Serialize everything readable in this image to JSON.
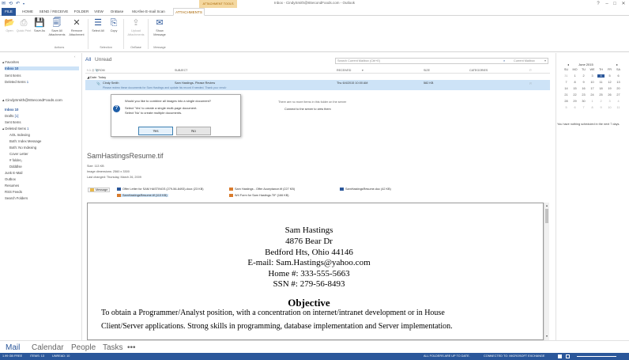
{
  "window": {
    "title": "Inbox - CindySmith@8SecondFoods.com - Outlook",
    "context_tab_group": "ATTACHMENT TOOLS"
  },
  "ribbon_tabs": [
    "FILE",
    "HOME",
    "SEND / RECEIVE",
    "FOLDER",
    "VIEW",
    "OnBase",
    "McAfee E-mail Scan",
    "ATTACHMENTS"
  ],
  "ribbon": {
    "buttons": [
      {
        "label": "Open",
        "icon": "open-icon"
      },
      {
        "label": "Quick Print",
        "icon": "printer-icon"
      },
      {
        "label": "Save As",
        "icon": "save-icon"
      },
      {
        "label": "Save All Attachments",
        "icon": "save-all-icon"
      },
      {
        "label": "Remove Attachment",
        "icon": "remove-icon"
      },
      {
        "label": "Select All",
        "icon": "select-all-icon"
      },
      {
        "label": "Copy",
        "icon": "copy-icon"
      },
      {
        "label": "Upload Attachments",
        "icon": "upload-icon"
      },
      {
        "label": "Show Message",
        "icon": "show-message-icon"
      }
    ],
    "groups": [
      "Actions",
      "Selection",
      "OnBase",
      "Message"
    ]
  },
  "folders": {
    "favorites_header": "Favorites",
    "favorites": [
      {
        "label": "Inbox",
        "count": "10"
      },
      {
        "label": "Sent Items",
        "count": ""
      },
      {
        "label": "Deleted Items",
        "count": "1"
      }
    ],
    "account": "CindySmith@8SecondFoods.com",
    "items": [
      {
        "label": "Inbox",
        "count": "10"
      },
      {
        "label": "Drafts",
        "count": "[1]"
      },
      {
        "label": "Sent Items",
        "count": ""
      },
      {
        "label": "Deleted Items",
        "count": "1"
      },
      {
        "label": "AOL Indexing",
        "count": ""
      },
      {
        "label": "Both: Index Message",
        "count": ""
      },
      {
        "label": "Both: No Indexing",
        "count": ""
      },
      {
        "label": "Cover Letter",
        "count": ""
      },
      {
        "label": "# folder₂",
        "count": ""
      },
      {
        "label": "Ddddlse",
        "count": ""
      },
      {
        "label": "Junk E-Mail",
        "count": ""
      },
      {
        "label": "Outbox",
        "count": ""
      },
      {
        "label": "Resumes",
        "count": ""
      },
      {
        "label": "RSS Feeds",
        "count": ""
      },
      {
        "label": "Search Folders",
        "count": ""
      }
    ]
  },
  "message_list": {
    "filter_all": "All",
    "filter_unread": "Unread",
    "search_placeholder": "Search Current Mailbox (Ctrl+E)",
    "search_scope": "Current Mailbox",
    "columns": [
      "FROM",
      "SUBJECT",
      "RECEIVED",
      "SIZE",
      "CATEGORIES"
    ],
    "group_header": "Date: Today",
    "row": {
      "from": "Cindy Smith",
      "subject": "Sam Hastings- Please Review",
      "preview": "Please review these documents for Sam Hastings and update his record if needed. Thank you <end>",
      "received": "Thu 6/4/2015 10:00 AM",
      "size": "582 KB"
    },
    "no_more_items": "There are no more items in this folder on the server",
    "connect_link": "Connect to the server to view them"
  },
  "dialog": {
    "question": "Would you like to combine all images into a single document?",
    "line1": "Select 'Yes' to create a single multi-page document.",
    "line2": "Select 'No' to create multiple documents.",
    "yes": "Yes",
    "no": "No"
  },
  "preview": {
    "file_name": "SamHastingsResume.tif",
    "size_line": "Size:  113 KB",
    "dims_line": "Image dimensions:   2560 x 3300",
    "changed_line": "Last changed:   Thursday, March 26, 2009",
    "message_label": "Message",
    "attachments": [
      {
        "label": "Offer Letter for SAM HASTINGS (279-56-8493).docx (23 KB)",
        "icon": "word-icon"
      },
      {
        "label": "Sam Hastings - Offer Acceptance.tif (227 KB)",
        "icon": "image-icon"
      },
      {
        "label": "SamHastingsResume.doc (42 KB)",
        "icon": "word-icon"
      },
      {
        "label": "SamHastingsResume.tif (113 KB)",
        "icon": "image-icon"
      },
      {
        "label": "W4 Form for Sam Hastings.TIF (166 KB)",
        "icon": "image-icon"
      }
    ],
    "document": {
      "name": "Sam Hastings",
      "address1": "4876 Bear Dr",
      "address2": "Bedford Hts, Ohio 44146",
      "email": "E-mail: Sam.Hastings@yahoo.com",
      "phone": "Home #: 333-555-5663",
      "ssn": "SSN #: 279-56-8493",
      "heading": "Objective",
      "objective1": "To obtain a Programmer/Analyst position, with a concentration on internet/intranet development or in House",
      "objective2": "Client/Server applications. Strong skills in programming, database implementation and Server implementation."
    }
  },
  "calendar": {
    "month": "June 2015",
    "day_headers": [
      "SU",
      "MO",
      "TU",
      "WE",
      "TH",
      "FR",
      "SA"
    ],
    "weeks": [
      [
        "31",
        "1",
        "2",
        "3",
        "4",
        "5",
        "6"
      ],
      [
        "7",
        "8",
        "9",
        "10",
        "11",
        "12",
        "13"
      ],
      [
        "14",
        "15",
        "16",
        "17",
        "18",
        "19",
        "20"
      ],
      [
        "21",
        "22",
        "23",
        "24",
        "25",
        "26",
        "27"
      ],
      [
        "28",
        "29",
        "30",
        "1",
        "2",
        "3",
        "4"
      ],
      [
        "5",
        "6",
        "7",
        "8",
        "9",
        "10",
        "11"
      ]
    ],
    "today": "4",
    "no_appointments": "You have nothing scheduled in the next 7 days."
  },
  "nav": [
    "Mail",
    "Calendar",
    "People",
    "Tasks",
    "•••"
  ],
  "status": {
    "free": "1.99 GB FREE",
    "items": "ITEMS: 13",
    "unread": "UNREAD: 10",
    "folders": "ALL FOLDERS ARE UP TO DATE.",
    "connection": "CONNECTED TO: MICROSOFT EXCHANGE"
  },
  "colors": {
    "accent": "#2b579a",
    "context": "#a86400",
    "selection": "#cde3f7"
  }
}
